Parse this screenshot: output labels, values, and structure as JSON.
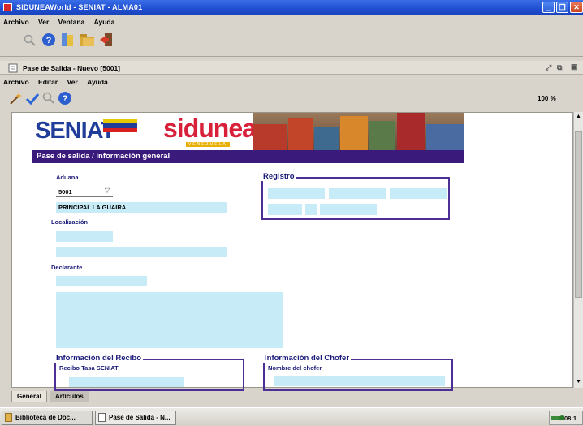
{
  "window": {
    "title": "SIDUNEAWorld - SENIAT - ALMA01"
  },
  "app_menu": [
    "Archivo",
    "Ver",
    "Ventana",
    "Ayuda"
  ],
  "document": {
    "title": "Pase de Salida - Nuevo [5001]",
    "menu": [
      "Archivo",
      "Editar",
      "Ver",
      "Ayuda"
    ],
    "zoom": "100 %"
  },
  "form": {
    "logo_seniat": "SENIAT",
    "logo_sidunea": "sidunea",
    "logo_sidunea_sub": "VENEZUELA",
    "header_title": "Pase de salida / información general",
    "aduana_label": "Aduana",
    "aduana_code": "5001",
    "aduana_name": "PRINCIPAL LA GUAIRA",
    "localizacion_label": "Localización",
    "declarante_label": "Declarante",
    "registro_title": "Registro",
    "recibo_title": "Información del Recibo",
    "recibo_label": "Recibo Tasa SENIAT",
    "chofer_title": "Información del Chofer",
    "chofer_label": "Nombre del chofer"
  },
  "tabs": [
    "General",
    "Artículos"
  ],
  "taskbar": {
    "items": [
      "Biblioteca de Doc...",
      "Pase de Salida - N..."
    ],
    "clock": "08:1"
  },
  "colors": {
    "field": "#c7ecf7",
    "banner": "#3a1a7a",
    "group_border": "#4c2f94",
    "titlebar": "#1f4fd0"
  }
}
